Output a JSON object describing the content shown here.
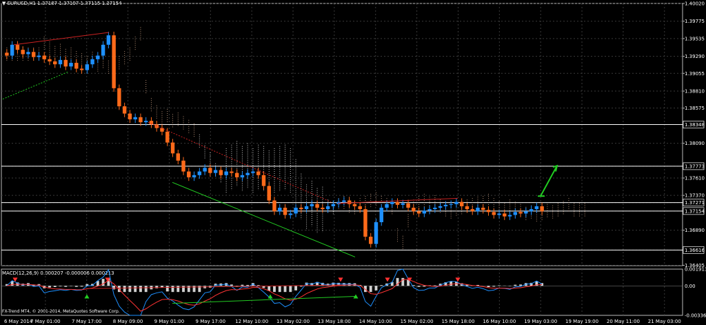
{
  "header": {
    "symbol": "EURUSD,H1",
    "ohlc": "1.37187 1.37197 1.37115 1.37154",
    "macd_label": "MACD(12,26,9) 0.000207 -0.000006 0.000213",
    "copyright": "FX-Trend MT4, © 2001-2014, MetaQuotes Software Corp."
  },
  "colors": {
    "background": "#000000",
    "grid": "#3a3a3a",
    "bull": "#1e90ff",
    "bear": "#ff6a1a",
    "cloud": "#e0b090",
    "cloud2": "#ffffff",
    "trend_red": "#cc2222",
    "trend_green": "#22cc22",
    "hline": "#ffffff",
    "macd_hist": "#d0d0d0",
    "macd_main": "#1e90ff",
    "macd_signal": "#ff3333",
    "arrow_up": "#22cc22",
    "arrow_down": "#ff3333"
  },
  "chart_data": [
    {
      "type": "candlestick",
      "title": "EURUSD,H1",
      "timeframe": "H1",
      "y_ticks": [
        "1.40020",
        "1.39775",
        "1.39535",
        "1.39290",
        "1.39055",
        "1.38810",
        "1.38575",
        "1.38348",
        "1.38090",
        "1.37773",
        "1.37610",
        "1.37370",
        "1.37271",
        "1.37154",
        "1.36890",
        "1.36616",
        "1.36405"
      ],
      "marked_levels": [
        "1.38348",
        "1.37773",
        "1.37271",
        "1.37154",
        "1.36616"
      ],
      "ylim": [
        1.364,
        1.4002
      ],
      "x_ticks": [
        "6 May 2014",
        "7 May 01:00",
        "7 May 17:00",
        "8 May 09:00",
        "9 May 01:00",
        "9 May 17:00",
        "12 May 10:00",
        "13 May 02:00",
        "13 May 18:00",
        "14 May 10:00",
        "15 May 02:00",
        "15 May 18:00",
        "16 May 10:00",
        "19 May 03:00",
        "19 May 19:00",
        "20 May 11:00",
        "21 May 03:00"
      ],
      "close_path": [
        1.393,
        1.3945,
        1.3938,
        1.3932,
        1.3935,
        1.3928,
        1.393,
        1.3925,
        1.3922,
        1.3918,
        1.3924,
        1.3915,
        1.392,
        1.3912,
        1.391,
        1.3918,
        1.3925,
        1.393,
        1.3945,
        1.3958,
        1.3885,
        1.386,
        1.385,
        1.3842,
        1.3845,
        1.3838,
        1.384,
        1.3835,
        1.383,
        1.3825,
        1.381,
        1.3795,
        1.3785,
        1.377,
        1.3762,
        1.3765,
        1.377,
        1.3775,
        1.3768,
        1.3772,
        1.3765,
        1.377,
        1.3768,
        1.3762,
        1.3765,
        1.3768,
        1.377,
        1.3765,
        1.375,
        1.373,
        1.3715,
        1.372,
        1.371,
        1.3712,
        1.372,
        1.3718,
        1.3722,
        1.3725,
        1.372,
        1.3718,
        1.3722,
        1.3725,
        1.3728,
        1.373,
        1.3725,
        1.3722,
        1.3718,
        1.368,
        1.367,
        1.37,
        1.372,
        1.3725,
        1.3728,
        1.3724,
        1.3726,
        1.372,
        1.3715,
        1.3712,
        1.3716,
        1.3718,
        1.372,
        1.3722,
        1.3724,
        1.3725,
        1.3728,
        1.3722,
        1.3718,
        1.3715,
        1.372,
        1.3717,
        1.3714,
        1.371,
        1.3712,
        1.3708,
        1.371,
        1.3714,
        1.3712,
        1.3715,
        1.3718,
        1.3722,
        1.3715
      ],
      "current_price": "1.37154"
    },
    {
      "type": "line",
      "title": "MACD(12,26,9) 0.000207 -0.000006 0.000213",
      "y_ticks": [
        "0.001913",
        "0.00",
        "-0.003366"
      ],
      "ylim": [
        -0.003366,
        0.001913
      ]
    }
  ]
}
